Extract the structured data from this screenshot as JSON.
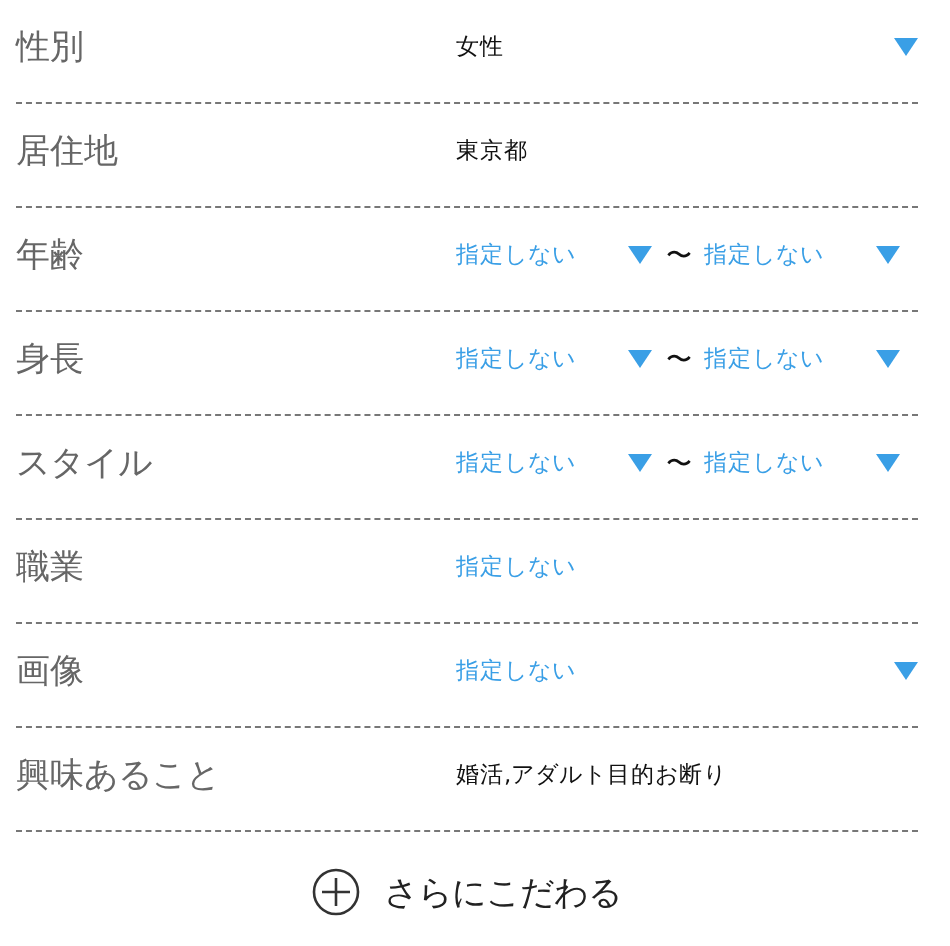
{
  "fields": [
    {
      "label": "性別",
      "kind": "select",
      "values": [
        {
          "text": "女性",
          "specified": true
        }
      ]
    },
    {
      "label": "居住地",
      "kind": "text",
      "values": [
        {
          "text": "東京都",
          "specified": true
        }
      ]
    },
    {
      "label": "年齢",
      "kind": "range",
      "separator": "〜",
      "values": [
        {
          "text": "指定しない",
          "specified": false
        },
        {
          "text": "指定しない",
          "specified": false
        }
      ]
    },
    {
      "label": "身長",
      "kind": "range",
      "separator": "〜",
      "values": [
        {
          "text": "指定しない",
          "specified": false
        },
        {
          "text": "指定しない",
          "specified": false
        }
      ]
    },
    {
      "label": "スタイル",
      "kind": "range",
      "separator": "〜",
      "values": [
        {
          "text": "指定しない",
          "specified": false
        },
        {
          "text": "指定しない",
          "specified": false
        }
      ]
    },
    {
      "label": "職業",
      "kind": "text",
      "values": [
        {
          "text": "指定しない",
          "specified": false
        }
      ]
    },
    {
      "label": "画像",
      "kind": "select",
      "values": [
        {
          "text": "指定しない",
          "specified": false
        }
      ]
    },
    {
      "label": "興味あること",
      "kind": "text",
      "values": [
        {
          "text": "婚活,アダルト目的お断り",
          "specified": true
        }
      ]
    }
  ],
  "more_button": {
    "label": "さらにこだわる"
  }
}
